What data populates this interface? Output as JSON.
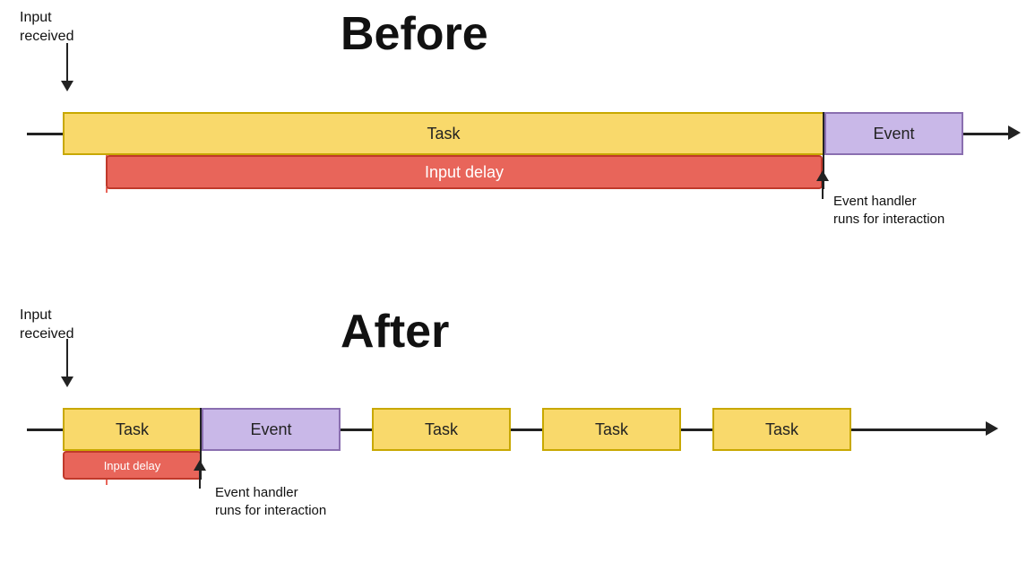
{
  "before": {
    "title": "Before",
    "input_received_label": "Input\nreceived",
    "task_label": "Task",
    "event_label": "Event",
    "input_delay_label": "Input delay",
    "event_handler_label": "Event handler\nruns for interaction"
  },
  "after": {
    "title": "After",
    "input_received_label": "Input\nreceived",
    "task_label_1": "Task",
    "event_label": "Event",
    "task_label_2": "Task",
    "task_label_3": "Task",
    "task_label_4": "Task",
    "input_delay_label": "Input delay",
    "event_handler_label": "Event handler\nruns for interaction"
  }
}
